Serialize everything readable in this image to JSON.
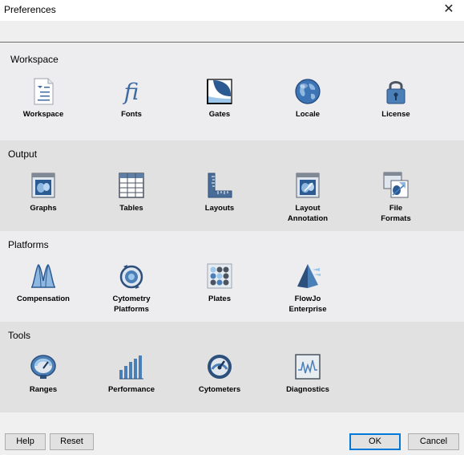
{
  "window": {
    "title": "Preferences",
    "close_glyph": "✕"
  },
  "sections": {
    "workspace": {
      "title": "Workspace",
      "items": [
        {
          "label": "Workspace",
          "icon": "workspace-document-icon"
        },
        {
          "label": "Fonts",
          "icon": "fonts-fi-icon"
        },
        {
          "label": "Gates",
          "icon": "gates-icon"
        },
        {
          "label": "Locale",
          "icon": "globe-icon"
        },
        {
          "label": "License",
          "icon": "padlock-icon"
        }
      ]
    },
    "output": {
      "title": "Output",
      "items": [
        {
          "label": "Graphs",
          "icon": "graphs-icon"
        },
        {
          "label": "Tables",
          "icon": "table-grid-icon"
        },
        {
          "label": "Layouts",
          "icon": "ruler-icon"
        },
        {
          "label": "Layout\nAnnotation",
          "icon": "layout-annotation-icon"
        },
        {
          "label": "File\nFormats",
          "icon": "file-formats-icon"
        }
      ]
    },
    "platforms": {
      "title": "Platforms",
      "items": [
        {
          "label": "Compensation",
          "icon": "compensation-peaks-icon"
        },
        {
          "label": "Cytometry\nPlatforms",
          "icon": "cytometry-platforms-icon"
        },
        {
          "label": "Plates",
          "icon": "plates-icon"
        },
        {
          "label": "FlowJo\nEnterprise",
          "icon": "enterprise-pyramid-icon"
        }
      ]
    },
    "tools": {
      "title": "Tools",
      "items": [
        {
          "label": "Ranges",
          "icon": "range-gauge-icon"
        },
        {
          "label": "Performance",
          "icon": "bar-chart-icon"
        },
        {
          "label": "Cytometers",
          "icon": "cytometer-dial-icon"
        },
        {
          "label": "Diagnostics",
          "icon": "diagnostics-waveform-icon"
        }
      ]
    }
  },
  "buttons": {
    "help": "Help",
    "reset": "Reset",
    "ok": "OK",
    "cancel": "Cancel"
  },
  "colors": {
    "icon_blue": "#4a7fb8",
    "icon_dark": "#2c4f7c",
    "icon_light": "#9cc6ea",
    "default_button_border": "#0078d7"
  }
}
